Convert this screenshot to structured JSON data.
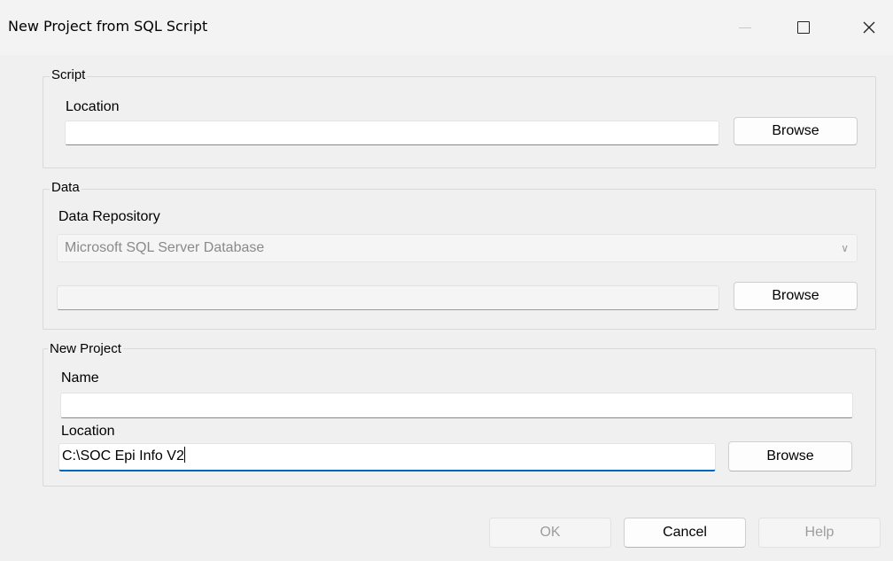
{
  "window": {
    "title": "New Project from SQL Script",
    "controls": {
      "minimize": "minimize-icon",
      "maximize": "maximize-icon",
      "close": "close-icon"
    }
  },
  "script_group": {
    "legend": "Script",
    "location_label": "Location",
    "location_value": "",
    "browse_label": "Browse"
  },
  "data_group": {
    "legend": "Data",
    "repository_label": "Data Repository",
    "repository_selected": "Microsoft SQL Server Database",
    "connection_value": "",
    "browse_label": "Browse"
  },
  "project_group": {
    "legend": "New Project",
    "name_label": "Name",
    "name_value": "",
    "location_label": "Location",
    "location_value": "C:\\SOC Epi Info V2",
    "browse_label": "Browse"
  },
  "footer": {
    "ok_label": "OK",
    "cancel_label": "Cancel",
    "help_label": "Help"
  }
}
